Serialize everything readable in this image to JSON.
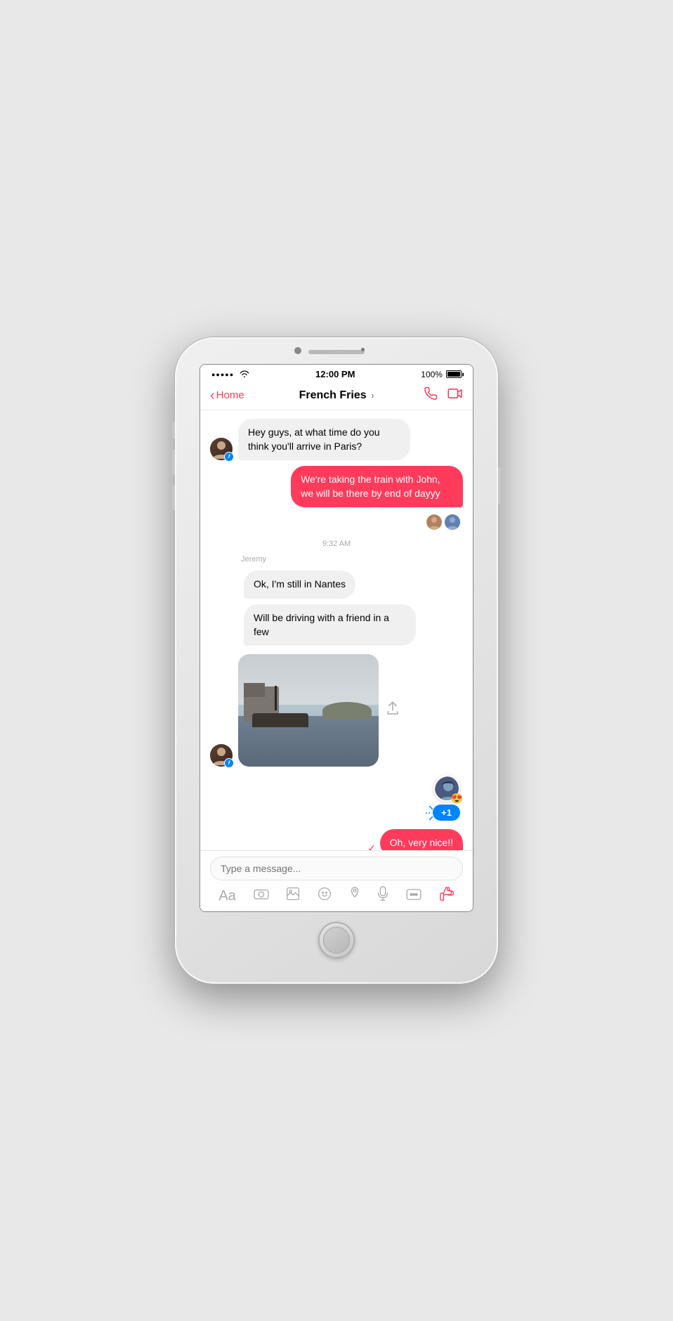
{
  "phone": {
    "status_bar": {
      "signal": "●●●●●",
      "wifi": "wifi",
      "time": "12:00 PM",
      "battery_pct": "100%"
    },
    "nav": {
      "back_label": "Home",
      "title": "French Fries",
      "chevron": ">",
      "phone_icon": "phone",
      "video_icon": "video"
    },
    "messages": [
      {
        "id": "msg1",
        "type": "received",
        "text": "Hey guys, at what time do you think you'll arrive in Paris?",
        "sender": "user1",
        "avatar": true
      },
      {
        "id": "msg2",
        "type": "sent",
        "text": "We're taking the train with John, we will be there by end of dayyy",
        "avatars": [
          "avatar1",
          "avatar2"
        ]
      },
      {
        "id": "ts1",
        "type": "timestamp",
        "text": "9:32 AM"
      },
      {
        "id": "sender1",
        "type": "sender",
        "name": "Jeremy"
      },
      {
        "id": "msg3",
        "type": "received",
        "text": "Ok, I'm still in Nantes"
      },
      {
        "id": "msg4",
        "type": "received",
        "text": "Will be driving with a friend in a few"
      },
      {
        "id": "msg5",
        "type": "image",
        "alt": "River landscape photo"
      },
      {
        "id": "msg6",
        "type": "reaction",
        "emoji": "😍",
        "plus_one": "+1"
      },
      {
        "id": "msg7",
        "type": "sent",
        "text": "Oh, very nice!!",
        "checkmark": true
      }
    ],
    "input": {
      "placeholder": "Type a message..."
    },
    "toolbar": {
      "icons": [
        "Aa",
        "📷",
        "🖼",
        "😊",
        "📍",
        "🎤",
        "💬",
        "👍"
      ]
    }
  }
}
